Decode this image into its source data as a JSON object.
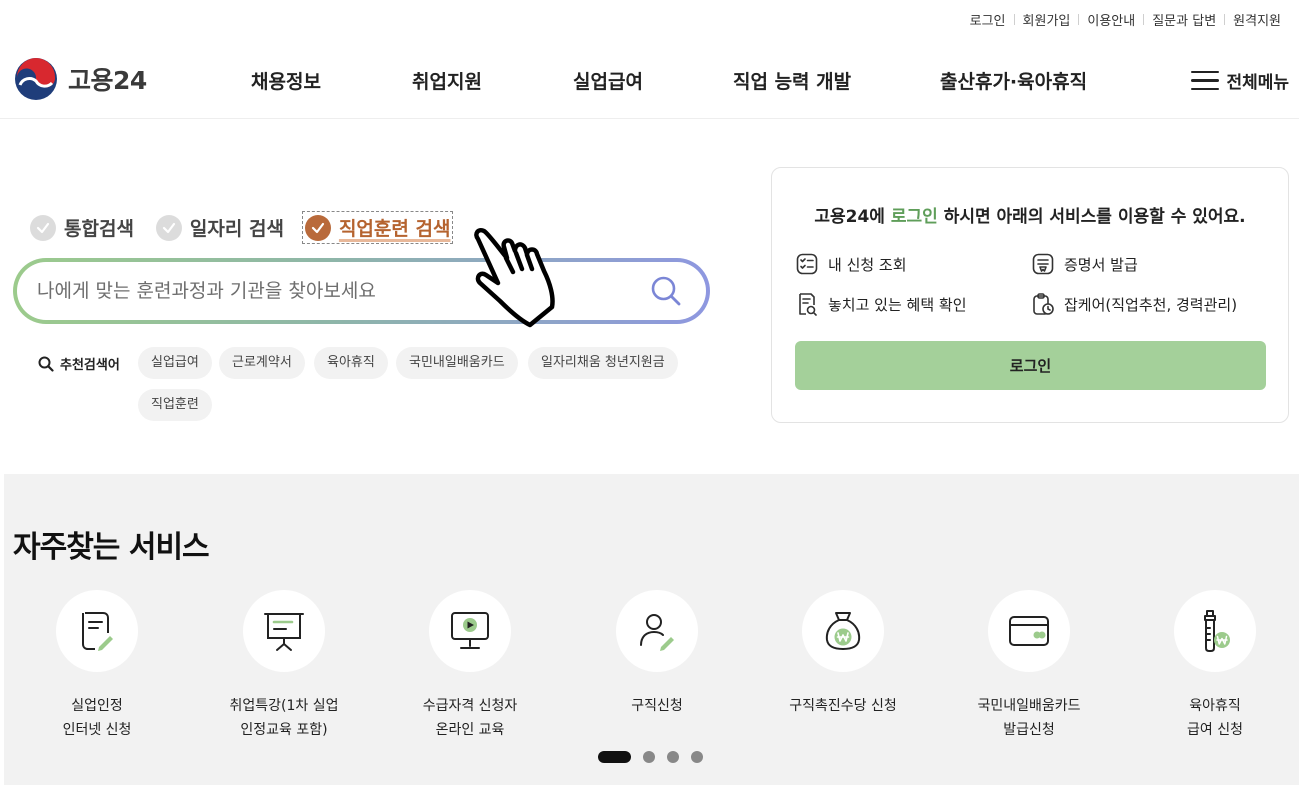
{
  "util_links": [
    "로그인",
    "회원가입",
    "이용안내",
    "질문과 답변",
    "원격지원"
  ],
  "logo": {
    "text": "고용24",
    "icon": "taegeuk-logo-icon"
  },
  "nav": [
    "채용정보",
    "취업지원",
    "실업급여",
    "직업 능력 개발",
    "출산휴가·육아휴직"
  ],
  "all_menu": {
    "label": "전체메뉴",
    "icon": "hamburger-icon"
  },
  "search": {
    "tabs": [
      {
        "label": "통합검색",
        "active": false
      },
      {
        "label": "일자리 검색",
        "active": false
      },
      {
        "label": "직업훈련 검색",
        "active": true
      }
    ],
    "placeholder": "나에게 맞는 훈련과정과 기관을 찾아보세요",
    "value": "",
    "reco_title": "추천검색어",
    "keywords": [
      "실업급여",
      "근로계약서",
      "육아휴직",
      "국민내일배움카드",
      "일자리채움 청년지원금",
      "직업훈련"
    ]
  },
  "login_panel": {
    "msg_prefix": "고용24에 ",
    "msg_highlight": "로그인",
    "msg_suffix": " 하시면 아래의 서비스를 이용할 수 있어요.",
    "services": [
      {
        "label": "내 신청 조회",
        "icon": "checklist-icon"
      },
      {
        "label": "증명서 발급",
        "icon": "certificate-icon"
      },
      {
        "label": "놓치고 있는 혜택 확인",
        "icon": "document-search-icon"
      },
      {
        "label": "잡케어(직업추천, 경력관리)",
        "icon": "clipboard-clock-icon"
      }
    ],
    "button": "로그인"
  },
  "frequent": {
    "title": "자주찾는 서비스",
    "items": [
      {
        "line1": "실업인정",
        "line2": "인터넷 신청",
        "icon": "document-pen-icon"
      },
      {
        "line1": "취업특강(1차 실업",
        "line2": "인정교육 포함)",
        "icon": "presentation-board-icon"
      },
      {
        "line1": "수급자격 신청자",
        "line2": "온라인 교육",
        "icon": "monitor-play-icon"
      },
      {
        "line1": "구직신청",
        "line2": "",
        "icon": "person-pen-icon"
      },
      {
        "line1": "구직촉진수당 신청",
        "line2": "",
        "icon": "money-bag-won-icon"
      },
      {
        "line1": "국민내일배움카드",
        "line2": "발급신청",
        "icon": "card-icon"
      },
      {
        "line1": "육아휴직",
        "line2": "급여 신청",
        "icon": "baby-bottle-won-icon"
      }
    ],
    "pagination": {
      "pages": 4,
      "current": 1
    }
  },
  "colors": {
    "accent_green": "#5f9e5a",
    "login_button": "#a4d09a",
    "active_tab": "#b5632f"
  }
}
